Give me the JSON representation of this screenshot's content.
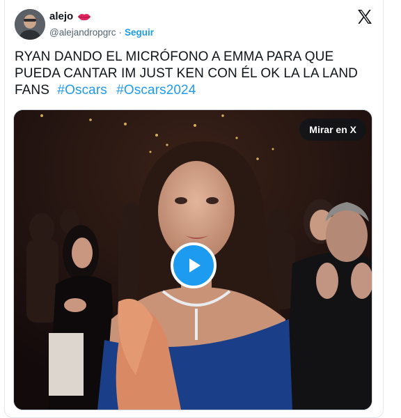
{
  "tweet": {
    "author": {
      "display_name": "alejo",
      "handle": "@alejandropgrc",
      "separator": "·",
      "follow_label": "Seguir",
      "emoji_icon": "kiss-mark-icon",
      "avatar_icon": "avatar"
    },
    "text_line1": "RYAN DANDO EL MICRÓFONO A EMMA PARA QUE",
    "text_line2": "PUEDA CANTAR IM JUST KEN CON ÉL OK LA LA LAND",
    "text_line3": "FANS",
    "hashtags": [
      "#Oscars",
      "#Oscars2024"
    ],
    "media": {
      "watch_label": "Mirar en X",
      "play_icon": "play-icon"
    },
    "platform_icon": "x-logo-icon"
  },
  "colors": {
    "accent": "#1d9bf0",
    "text": "#0f1419",
    "muted": "#536471"
  }
}
